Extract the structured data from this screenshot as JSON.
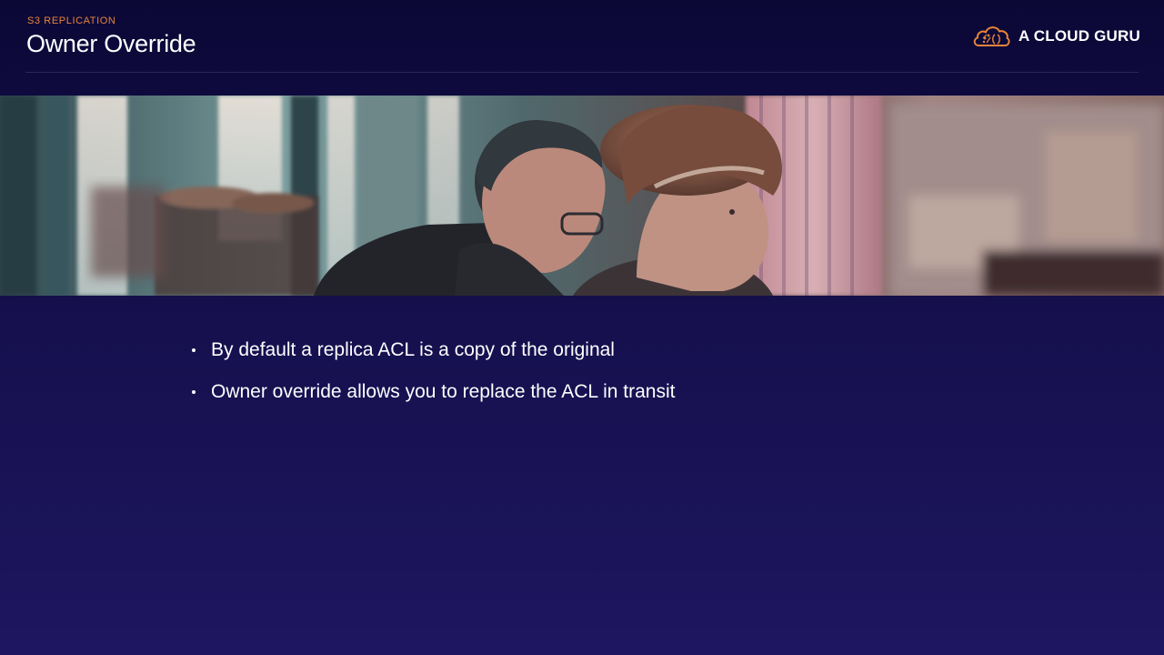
{
  "header": {
    "section_label": "S3 REPLICATION",
    "title": "Owner Override"
  },
  "brand": {
    "name": "A CLOUD GURU",
    "logo_icon": "cloud-logo-icon",
    "accent_color": "#e8843a"
  },
  "hero_image": {
    "subject": "photo-banner"
  },
  "bullets": [
    "By default a replica ACL is a copy of the original",
    "Owner override allows you to replace the ACL in transit"
  ],
  "colors": {
    "background_top": "#0b0836",
    "background_bottom": "#1e1660",
    "text": "#ffffff",
    "accent": "#e8843a"
  }
}
